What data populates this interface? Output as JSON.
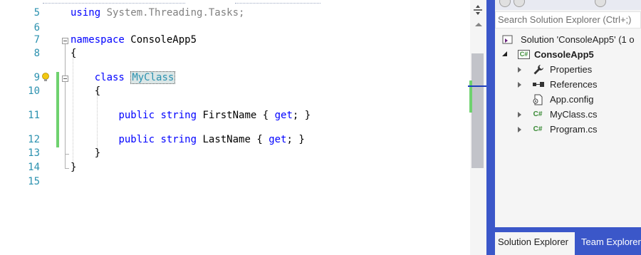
{
  "editor": {
    "lines": [
      {
        "num": "5",
        "html": "<span class=\"kw\">using</span><span class=\"grey\"> System.Threading.Tasks;</span>"
      },
      {
        "num": "6",
        "html": ""
      },
      {
        "num": "7",
        "html": "<span class=\"kw\">namespace</span> ConsoleApp5"
      },
      {
        "num": "8",
        "html": "{"
      },
      {
        "num": "9",
        "html": "    <span class=\"kw\">class</span> <span class=\"hl\">MyClass</span>"
      },
      {
        "num": "10",
        "html": "    {"
      },
      {
        "num": "11",
        "html": "        <span class=\"kw\">public</span> <span class=\"kw\">string</span> FirstName { <span class=\"kw\">get</span>; }"
      },
      {
        "num": "12",
        "html": "        <span class=\"kw\">public</span> <span class=\"kw\">string</span> LastName { <span class=\"kw\">get</span>; }"
      },
      {
        "num": "13",
        "html": "    }"
      },
      {
        "num": "14",
        "html": "}"
      },
      {
        "num": "15",
        "html": ""
      }
    ],
    "accent_keyword": "#0000ff",
    "accent_type": "#2b91af",
    "change_marker": "#6fd26f"
  },
  "solution_explorer": {
    "search_placeholder": "Search Solution Explorer (Ctrl+;)",
    "solution_label": "Solution 'ConsoleApp5' (1 o",
    "project_label": "ConsoleApp5",
    "items": [
      {
        "label": "Properties",
        "icon": "wrench-icon"
      },
      {
        "label": "References",
        "icon": "references-icon"
      },
      {
        "label": "App.config",
        "icon": "config-file-icon"
      },
      {
        "label": "MyClass.cs",
        "icon": "csharp-file-icon"
      },
      {
        "label": "Program.cs",
        "icon": "csharp-file-icon"
      }
    ],
    "cs_glyph": "C#",
    "tabs": {
      "active": "Solution Explorer",
      "inactive": "Team Explorer"
    },
    "frame_color": "#3b57c9"
  }
}
